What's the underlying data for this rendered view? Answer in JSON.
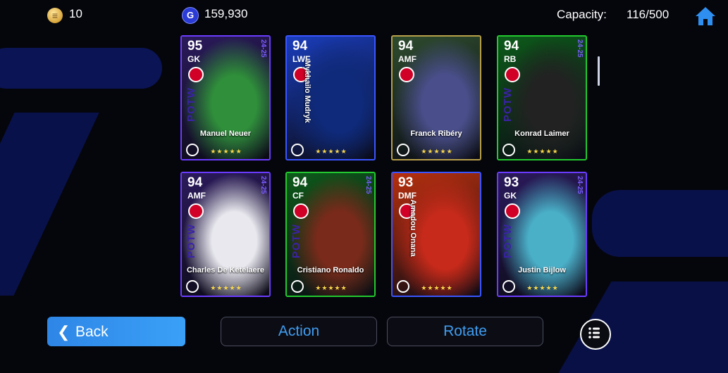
{
  "header": {
    "coins": "10",
    "gp": "159,930",
    "gp_icon_letter": "G",
    "capacity_label": "Capacity:",
    "capacity_value": "116/500"
  },
  "cards": [
    {
      "rating": "95",
      "position": "GK",
      "name": "Manuel Neuer",
      "tag": "POTW",
      "season": "24-25",
      "border": "#6b3cff",
      "bg": "#2b1a5c",
      "art": "#2f8f3a"
    },
    {
      "rating": "94",
      "position": "LWF",
      "name": "Mykhailo Mudryk",
      "tag": "",
      "season": "",
      "border": "#3a55ff",
      "bg": "#1a3dbb",
      "art": "#0f2a7a"
    },
    {
      "rating": "94",
      "position": "AMF",
      "name": "Franck Ribéry",
      "tag": "",
      "season": "",
      "border": "#b8a04a",
      "bg": "#2e4b2e",
      "art": "#4a4f8c"
    },
    {
      "rating": "94",
      "position": "RB",
      "name": "Konrad Laimer",
      "tag": "POTW",
      "season": "24-25",
      "border": "#23c92f",
      "bg": "#0d5a1a",
      "art": "#222"
    },
    {
      "rating": "94",
      "position": "AMF",
      "name": "Charles De Ketelaere",
      "tag": "POTW",
      "season": "24-25",
      "border": "#6b3cff",
      "bg": "#2b1a5c",
      "art": "#e8e8ee"
    },
    {
      "rating": "94",
      "position": "CF",
      "name": "Cristiano Ronaldo",
      "tag": "POTW",
      "season": "24-25",
      "border": "#23c92f",
      "bg": "#0d5a1a",
      "art": "#7a2a1a"
    },
    {
      "rating": "93",
      "position": "DMF",
      "name": "Amadou Onana",
      "tag": "",
      "season": "",
      "border": "#3a55ff",
      "bg": "#b8300e",
      "art": "#c72a1a"
    },
    {
      "rating": "93",
      "position": "GK",
      "name": "Justin Bijlow",
      "tag": "POTW",
      "season": "24-25",
      "border": "#6b3cff",
      "bg": "#2b1a5c",
      "art": "#4ab0c8"
    }
  ],
  "stars": "★★★★★",
  "buttons": {
    "back": "Back",
    "action": "Action",
    "rotate": "Rotate"
  }
}
